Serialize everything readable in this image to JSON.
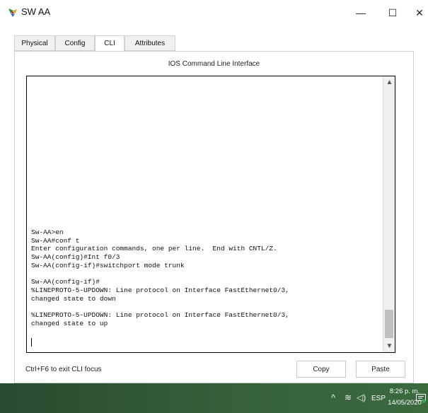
{
  "window": {
    "title": "SW AA"
  },
  "window_controls": {
    "minimize": "—",
    "maximize": "☐",
    "close": "✕"
  },
  "tabs": [
    {
      "label": "Physical",
      "active": false
    },
    {
      "label": "Config",
      "active": false
    },
    {
      "label": "CLI",
      "active": true
    },
    {
      "label": "Attributes",
      "active": false
    }
  ],
  "cli": {
    "heading": "IOS Command Line Interface",
    "lines": [
      "Sw-AA>en",
      "Sw-AA#conf t",
      "Enter configuration commands, one per line.  End with CNTL/Z.",
      "Sw-AA(config)#Int f0/3",
      "Sw-AA(config-if)#switchport mode trunk",
      "",
      "Sw-AA(config-if)#",
      "%LINEPROTO-5-UPDOWN: Line protocol on Interface FastEthernet0/3,",
      "changed state to down",
      "",
      "%LINEPROTO-5-UPDOWN: Line protocol on Interface FastEthernet0/3,",
      "changed state to up"
    ]
  },
  "footer": {
    "hint": "Ctrl+F6 to exit CLI focus",
    "copy_label": "Copy",
    "paste_label": "Paste"
  },
  "taskbar": {
    "language": "ESP",
    "time": "8:26 p. m.",
    "date": "14/05/2020"
  },
  "colors": {
    "taskbar": "#36613a",
    "terminal_border": "#000000"
  }
}
